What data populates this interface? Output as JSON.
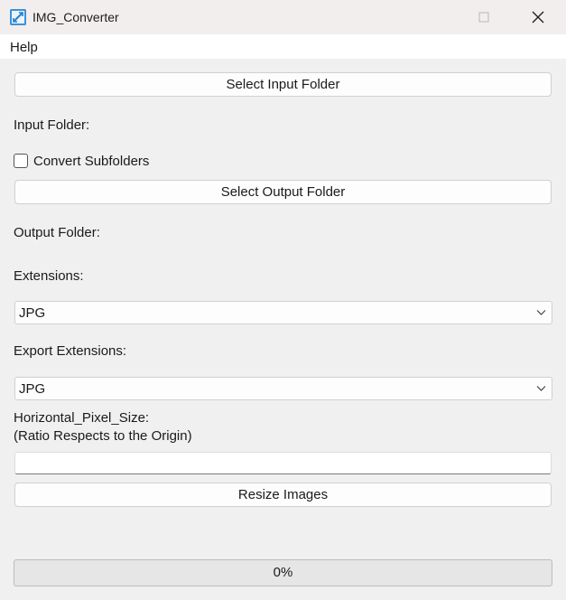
{
  "window": {
    "title": "IMG_Converter"
  },
  "menu": {
    "items": [
      {
        "label": "Help"
      }
    ]
  },
  "form": {
    "select_input_button": "Select Input Folder",
    "input_folder_label": "Input Folder:",
    "input_folder_value": "",
    "convert_subfolders_label": "Convert Subfolders",
    "convert_subfolders_checked": false,
    "select_output_button": "Select Output Folder",
    "output_folder_label": "Output Folder:",
    "output_folder_value": "",
    "extensions_label": "Extensions:",
    "extensions_selected": "JPG",
    "export_extensions_label": "Export Extensions:",
    "export_extensions_selected": "JPG",
    "pixel_size_label": "Horizontal_Pixel_Size:",
    "pixel_size_hint": "(Ratio Respects to the Origin)",
    "pixel_size_value": "",
    "resize_button": "Resize Images"
  },
  "progress": {
    "value": 0,
    "text": "0%",
    "fill_color": "#06b025"
  }
}
